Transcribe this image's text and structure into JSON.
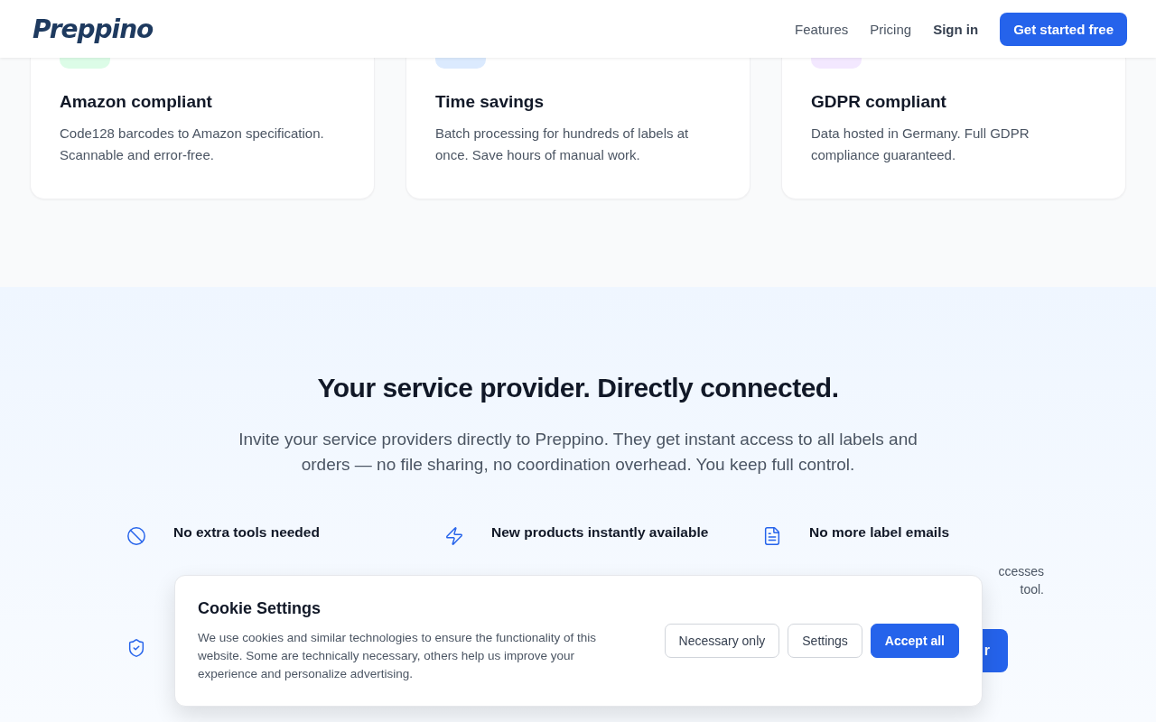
{
  "header": {
    "logo": "Preppino",
    "nav": [
      "Features",
      "Pricing",
      "Sign in"
    ],
    "cta": "Get started free"
  },
  "cards": [
    {
      "color": "#dcfce7",
      "title": "Amazon compliant",
      "text": "Code128 barcodes to Amazon specification. Scannable and error-free."
    },
    {
      "color": "#dbeafe",
      "title": "Time savings",
      "text": "Batch processing for hundreds of labels at once. Save hours of manual work."
    },
    {
      "color": "#f3e8ff",
      "title": "GDPR compliant",
      "text": "Data hosted in Germany. Full GDPR compliance guaranteed."
    }
  ],
  "section": {
    "title": "Your service provider. Directly connected.",
    "text": "Invite your service providers directly to Preppino. They get instant access to all labels and orders — no file sharing, no coordination overhead. You keep full control."
  },
  "features": [
    {
      "kind": "ban",
      "title": "No extra tools needed"
    },
    {
      "kind": "bolt",
      "title": "New products instantly available"
    },
    {
      "kind": "file",
      "title": "No more label emails",
      "lines": [
        "ccesses",
        "tool."
      ]
    }
  ],
  "features_row2": [
    {
      "kind": "shield"
    },
    {
      "kind": "none"
    },
    {
      "kind": "button",
      "label": "r"
    }
  ],
  "cookie": {
    "title": "Cookie Settings",
    "text": "We use cookies and similar technologies to ensure the functionality of this website. Some are technically necessary, others help us improve your experience and personalize advertising.",
    "buttons": [
      {
        "label": "Necessary only",
        "primary": false
      },
      {
        "label": "Settings",
        "primary": false
      },
      {
        "label": "Accept all",
        "primary": true
      }
    ]
  }
}
